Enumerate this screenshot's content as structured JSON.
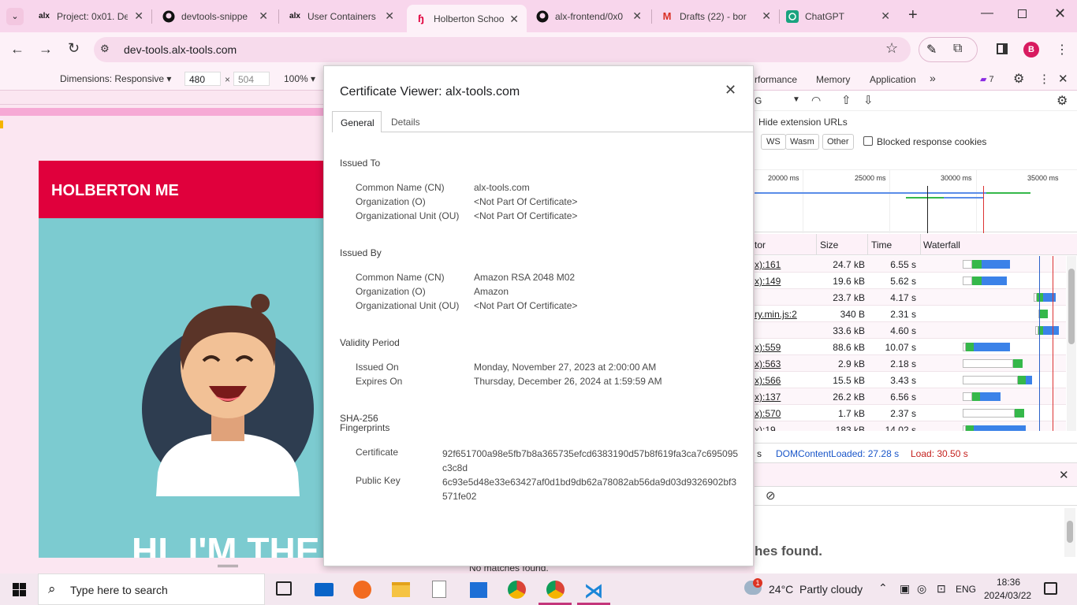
{
  "tabs": [
    {
      "title": "Project: 0x01. De",
      "icon": "alx-icon"
    },
    {
      "title": "devtools-snippe",
      "icon": "github-icon"
    },
    {
      "title": "User Containers",
      "icon": "alx-icon"
    },
    {
      "title": "Holberton Schoo",
      "icon": "holberton-icon",
      "active": true
    },
    {
      "title": "alx-frontend/0x0",
      "icon": "github-icon"
    },
    {
      "title": "Drafts (22) - bor",
      "icon": "gmail-icon"
    },
    {
      "title": "ChatGPT",
      "icon": "chatgpt-icon"
    }
  ],
  "address": {
    "url": "dev-tools.alx-tools.com",
    "profile_initial": "B"
  },
  "device_toolbar": {
    "dimensions": "Dimensions: Responsive",
    "width": "480",
    "height": "504",
    "times": "×",
    "zoom": "100%"
  },
  "page": {
    "brand": "HOLBERTON ME",
    "hero_text": "HI, I'M THE",
    "brand_color": "#e0003c",
    "hero_bg": "#7ccbd0"
  },
  "devtools": {
    "tabs": [
      "rformance",
      "Memory",
      "Application"
    ],
    "issues_count": "7",
    "throttle": "G",
    "hide_ext": "Hide extension URLs",
    "filters": [
      "WS",
      "Wasm",
      "Other"
    ],
    "blocked_cookies": "Blocked response cookies",
    "timeline_ticks": [
      "20000 ms",
      "25000 ms",
      "30000 ms",
      "35000 ms"
    ],
    "columns": {
      "initiator": "tor",
      "size": "Size",
      "time": "Time",
      "waterfall": "Waterfall"
    },
    "rows": [
      {
        "init": "x):161",
        "size": "24.7 kB",
        "time": "6.55 s"
      },
      {
        "init": "x):149",
        "size": "19.6 kB",
        "time": "5.62 s"
      },
      {
        "init": "",
        "size": "23.7 kB",
        "time": "4.17 s"
      },
      {
        "init": "ry.min.js:2",
        "size": "340 B",
        "time": "2.31 s"
      },
      {
        "init": "",
        "size": "33.6 kB",
        "time": "4.60 s"
      },
      {
        "init": "x):559",
        "size": "88.6 kB",
        "time": "10.07 s"
      },
      {
        "init": "x):563",
        "size": "2.9 kB",
        "time": "2.18 s"
      },
      {
        "init": "x):566",
        "size": "15.5 kB",
        "time": "3.43 s"
      },
      {
        "init": "x):137",
        "size": "26.2 kB",
        "time": "6.56 s"
      },
      {
        "init": "x):570",
        "size": "1.7 kB",
        "time": "2.37 s"
      },
      {
        "init": "x):19",
        "size": "183 kB",
        "time": "14.02 s"
      }
    ],
    "status_s": "s",
    "dom_loaded": "DOMContentLoaded: 27.28 s",
    "load": "Load: 30.50 s",
    "console_text": "hes found.",
    "no_matches": "No matches found."
  },
  "dialog": {
    "title": "Certificate Viewer: alx-tools.com",
    "tabs": [
      "General",
      "Details"
    ],
    "issued_to": {
      "heading": "Issued To",
      "rows": [
        {
          "label": "Common Name (CN)",
          "value": "alx-tools.com"
        },
        {
          "label": "Organization (O)",
          "value": "<Not Part Of Certificate>"
        },
        {
          "label": "Organizational Unit (OU)",
          "value": "<Not Part Of Certificate>"
        }
      ]
    },
    "issued_by": {
      "heading": "Issued By",
      "rows": [
        {
          "label": "Common Name (CN)",
          "value": "Amazon RSA 2048 M02"
        },
        {
          "label": "Organization (O)",
          "value": "Amazon"
        },
        {
          "label": "Organizational Unit (OU)",
          "value": "<Not Part Of Certificate>"
        }
      ]
    },
    "validity": {
      "heading": "Validity Period",
      "rows": [
        {
          "label": "Issued On",
          "value": "Monday, November 27, 2023 at 2:00:00 AM"
        },
        {
          "label": "Expires On",
          "value": "Thursday, December 26, 2024 at 1:59:59 AM"
        }
      ]
    },
    "fingerprints": {
      "heading1": "SHA-256",
      "heading2": "Fingerprints",
      "cert_label": "Certificate",
      "cert_value": "92f651700a98e5fb7b8a365735efcd6383190d57b8f619fa3ca7c695095c3c8d",
      "pk_label": "Public Key",
      "pk_value": "6c93e5d48e33e63427af0d1bd9db62a78082ab56da9d03d9326902bf3571fe02"
    }
  },
  "taskbar": {
    "search_placeholder": "Type here to search",
    "weather_temp": "24°C",
    "weather_desc": "Partly cloudy",
    "lang": "ENG",
    "time": "18:36",
    "date": "2024/03/22",
    "weather_badge": "1"
  }
}
